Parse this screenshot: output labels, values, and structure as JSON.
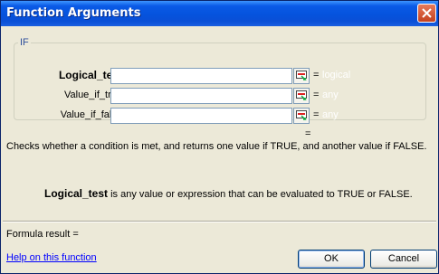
{
  "window": {
    "title": "Function Arguments"
  },
  "group": {
    "legend": "IF"
  },
  "args": [
    {
      "label": "Logical_test",
      "value": "",
      "eq": "=",
      "hint": "logical"
    },
    {
      "label": "Value_if_true",
      "value": "",
      "eq": "=",
      "hint": "any"
    },
    {
      "label": "Value_if_false",
      "value": "",
      "eq": "=",
      "hint": "any"
    }
  ],
  "result_eq": "=",
  "description": "Checks whether a condition is met, and returns one value if TRUE, and another value if FALSE.",
  "arg_description": {
    "name": "Logical_test",
    "text": " is any value or expression that can be evaluated to TRUE or FALSE."
  },
  "formula_result": "Formula result =",
  "help_link": "Help on this function",
  "buttons": {
    "ok": "OK",
    "cancel": "Cancel"
  },
  "colors": {
    "titlebar": "#0553dd",
    "dialog_bg": "#ece9d8",
    "link": "#0000ff",
    "close": "#c4411f"
  },
  "icons": [
    "close-icon",
    "collapse-dialog-icon"
  ]
}
